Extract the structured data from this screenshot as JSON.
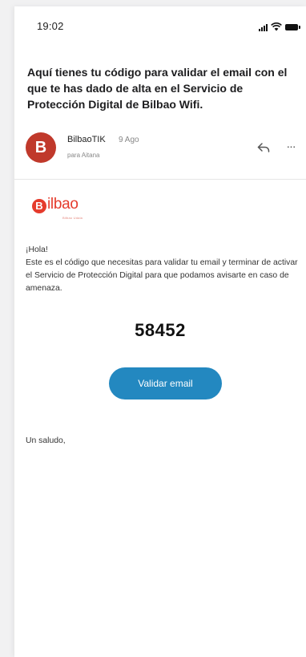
{
  "status_bar": {
    "time": "19:02",
    "icons": [
      "signal-icon",
      "wifi-icon",
      "battery-icon"
    ]
  },
  "email": {
    "subject": "Aquí tienes tu código para validar el email con el que te has dado de alta en el Servicio de Protección Digital de Bilbao Wifi.",
    "sender": {
      "avatar_letter": "B",
      "avatar_color": "#c0392b",
      "name": "BilbaoTIK",
      "date": "9 Ago",
      "to": "para Aitana"
    },
    "actions": {
      "reply_icon": "reply-icon",
      "more_icon": "more-icon",
      "more_glyph": "···"
    },
    "logo": {
      "letter": "B",
      "text": "ilbao",
      "tagline": "Bilbao Udala",
      "color": "#e53b2c"
    },
    "greeting": "¡Hola!",
    "paragraph": "Este es el código que necesitas para validar tu email y terminar de activar el Servicio de Protección Digital para que podamos avisarte en caso de amenaza.",
    "code": "58452",
    "button_label": "Validar email",
    "button_color": "#2388c0",
    "signoff": "Un saludo,"
  }
}
